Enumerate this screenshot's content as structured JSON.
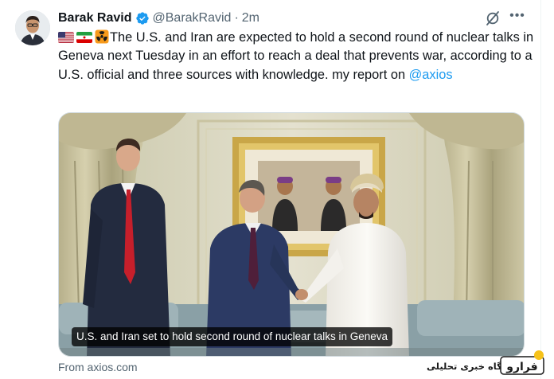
{
  "tweet": {
    "author_name": "Barak Ravid",
    "handle": "@BarakRavid",
    "separator": "·",
    "time": "2m",
    "more_label": "•••",
    "text_body": "The U.S. and Iran are expected to hold a second round of nuclear talks in Geneva next Tuesday in an effort to reach a deal that prevents war, according to a U.S. official and three sources with knowledge. my report on ",
    "mention": "@axios",
    "emoji": [
      "us-flag-icon",
      "iran-flag-icon",
      "radioactive-icon"
    ]
  },
  "card": {
    "caption": "U.S. and Iran set to hold second round of nuclear talks in Geneva",
    "source": "From axios.com"
  },
  "watermark": {
    "text": "پایگاه خبری تحلیلی",
    "logo_text": "فرارو"
  },
  "colors": {
    "link": "#1d9bf0",
    "secondary_text": "#536471",
    "verified": "#1d9bf0"
  }
}
